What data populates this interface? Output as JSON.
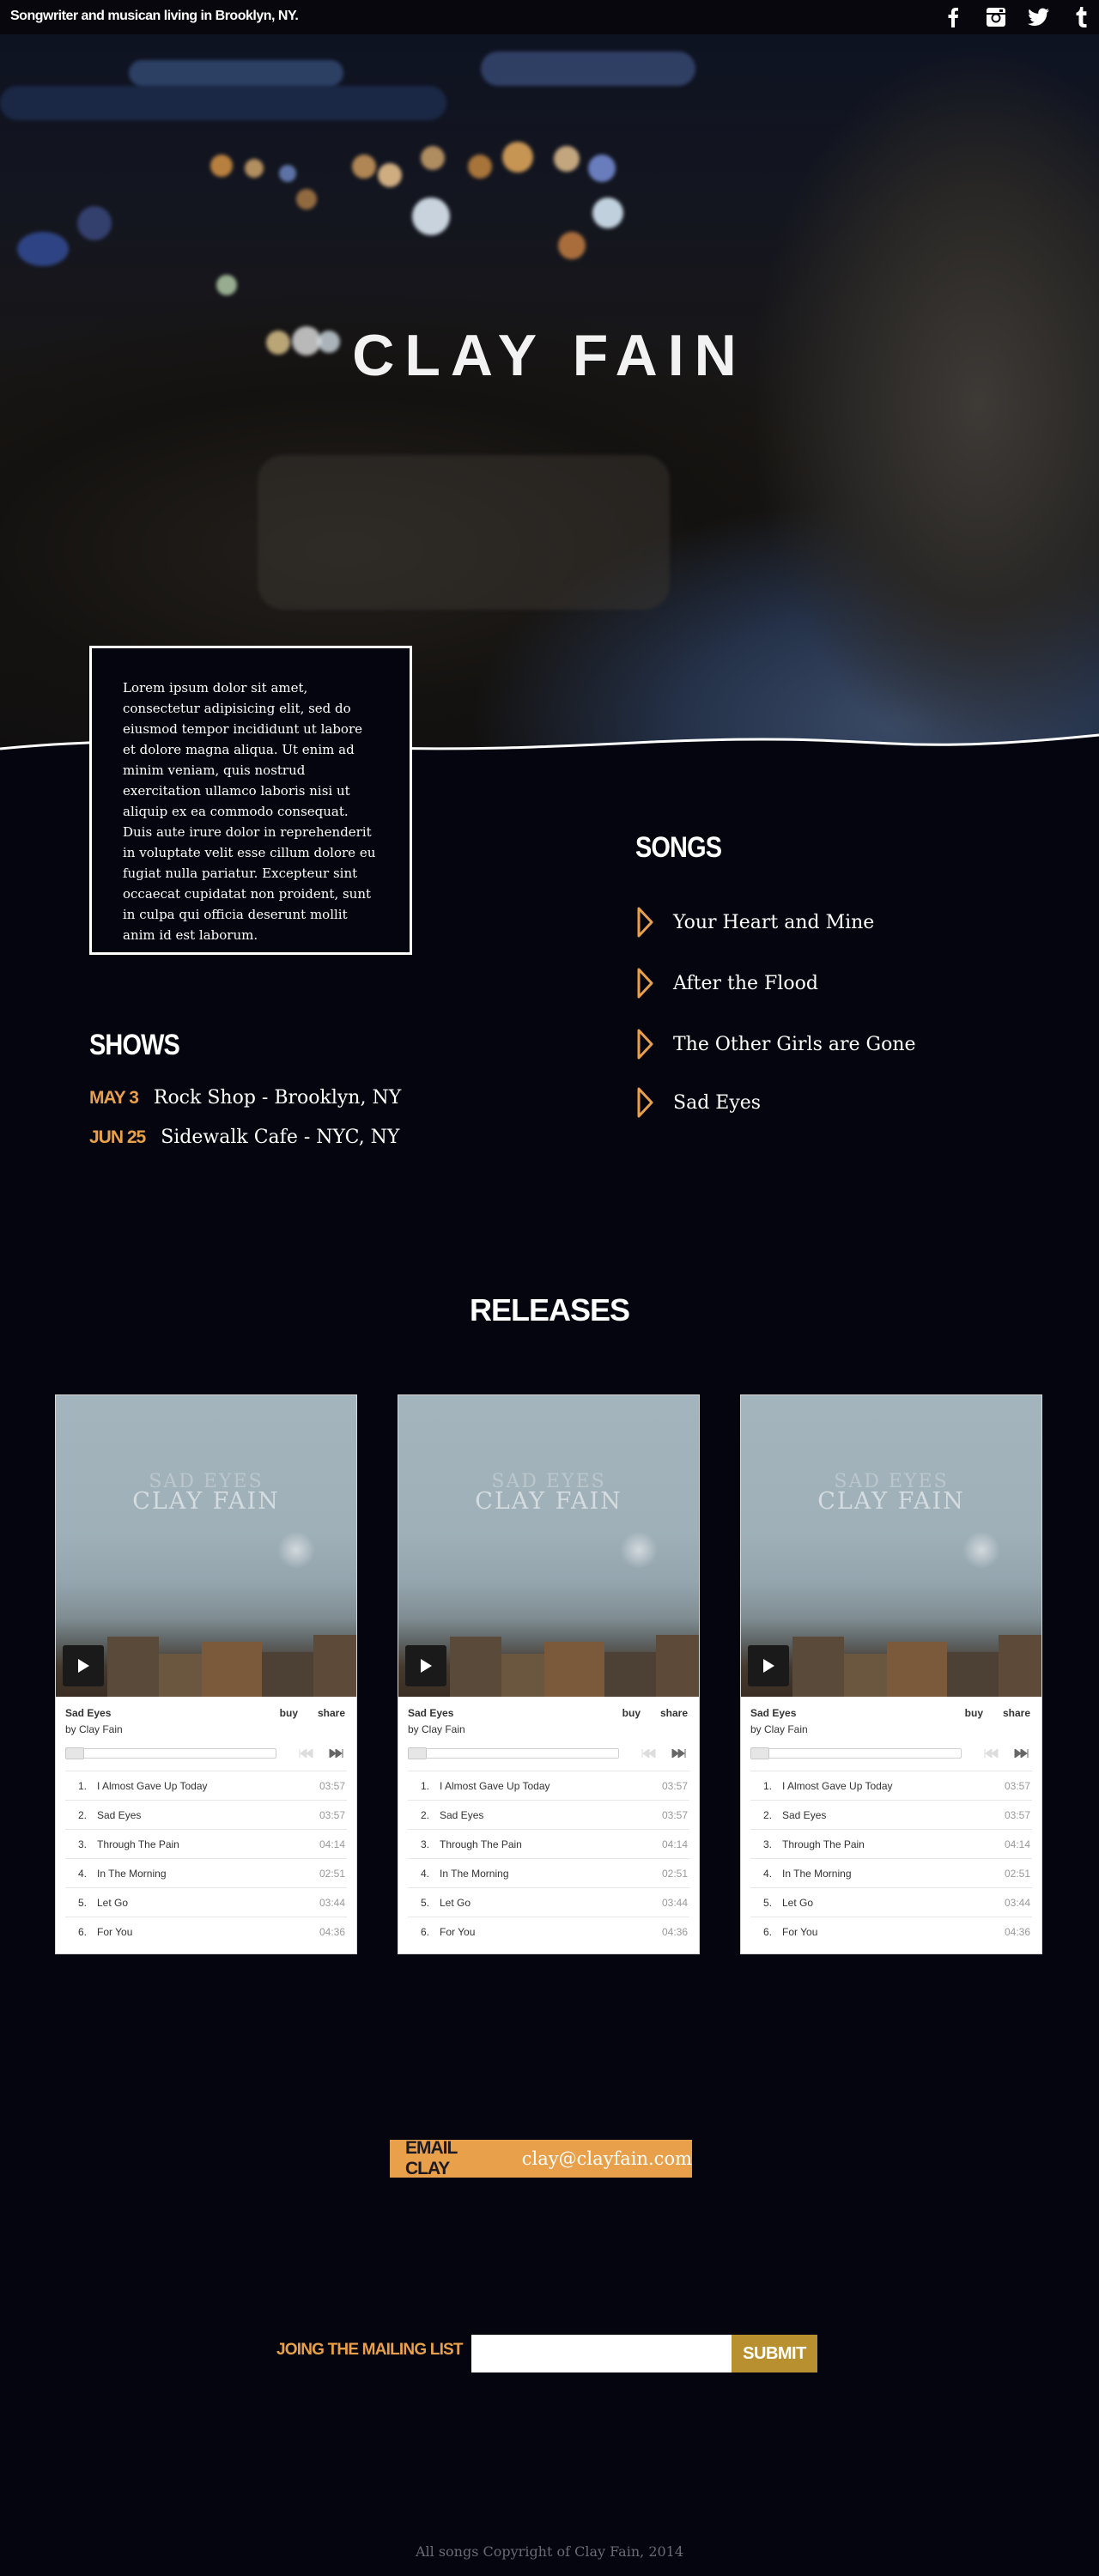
{
  "header": {
    "tagline": "Songwriter and musican living in Brooklyn, NY.",
    "social": [
      "facebook-icon",
      "instagram-icon",
      "twitter-icon",
      "tumblr-icon"
    ]
  },
  "hero": {
    "title": "CLAY FAIN"
  },
  "about": {
    "text": "Lorem ipsum dolor sit amet, consectetur adipisicing elit, sed do eiusmod tempor incididunt ut labore et dolore magna aliqua. Ut enim ad minim veniam, quis nostrud exercitation ullamco laboris nisi ut aliquip ex ea commodo consequat. Duis aute irure dolor in reprehenderit in voluptate velit esse cillum dolore eu fugiat nulla pariatur. Excepteur sint occaecat cupidatat non proident, sunt in culpa qui officia deserunt mollit anim id est laborum."
  },
  "shows": {
    "title": "SHOWS",
    "items": [
      {
        "date": "MAY 3",
        "venue": "Rock Shop - Brooklyn, NY"
      },
      {
        "date": "JUN 25",
        "venue": "Sidewalk Cafe - NYC, NY"
      }
    ]
  },
  "songs": {
    "title": "SONGS",
    "items": [
      "Your Heart and Mine",
      "After the Flood",
      "The Other Girls are Gone",
      "Sad Eyes"
    ]
  },
  "releases": {
    "title": "RELEASES",
    "players": [
      {
        "cover_line1": "SAD EYES",
        "cover_line2": "CLAY FAIN",
        "track": "Sad Eyes",
        "artist": "by Clay Fain",
        "buy": "buy",
        "share": "share",
        "tracks": [
          {
            "n": "1.",
            "title": "I Almost Gave Up Today",
            "dur": "03:57"
          },
          {
            "n": "2.",
            "title": "Sad Eyes",
            "dur": "03:57"
          },
          {
            "n": "3.",
            "title": "Through The Pain",
            "dur": "04:14"
          },
          {
            "n": "4.",
            "title": "In The Morning",
            "dur": "02:51"
          },
          {
            "n": "5.",
            "title": "Let Go",
            "dur": "03:44"
          },
          {
            "n": "6.",
            "title": "For You",
            "dur": "04:36"
          }
        ]
      },
      {
        "cover_line1": "SAD EYES",
        "cover_line2": "CLAY FAIN",
        "track": "Sad Eyes",
        "artist": "by Clay Fain",
        "buy": "buy",
        "share": "share",
        "tracks": [
          {
            "n": "1.",
            "title": "I Almost Gave Up Today",
            "dur": "03:57"
          },
          {
            "n": "2.",
            "title": "Sad Eyes",
            "dur": "03:57"
          },
          {
            "n": "3.",
            "title": "Through The Pain",
            "dur": "04:14"
          },
          {
            "n": "4.",
            "title": "In The Morning",
            "dur": "02:51"
          },
          {
            "n": "5.",
            "title": "Let Go",
            "dur": "03:44"
          },
          {
            "n": "6.",
            "title": "For You",
            "dur": "04:36"
          }
        ]
      },
      {
        "cover_line1": "SAD EYES",
        "cover_line2": "CLAY FAIN",
        "track": "Sad Eyes",
        "artist": "by Clay Fain",
        "buy": "buy",
        "share": "share",
        "tracks": [
          {
            "n": "1.",
            "title": "I Almost Gave Up Today",
            "dur": "03:57"
          },
          {
            "n": "2.",
            "title": "Sad Eyes",
            "dur": "03:57"
          },
          {
            "n": "3.",
            "title": "Through The Pain",
            "dur": "04:14"
          },
          {
            "n": "4.",
            "title": "In The Morning",
            "dur": "02:51"
          },
          {
            "n": "5.",
            "title": "Let Go",
            "dur": "03:44"
          },
          {
            "n": "6.",
            "title": "For You",
            "dur": "04:36"
          }
        ]
      }
    ]
  },
  "contact": {
    "label": "EMAIL CLAY",
    "email": "clay@clayfain.com"
  },
  "mailing": {
    "label": "JOING THE MAILING LIST",
    "placeholder": "",
    "submit": "SUBMIT"
  },
  "footer": {
    "text": "All songs Copyright of Clay Fain, 2014"
  },
  "colors": {
    "accent": "#e9a04a",
    "submit": "#b8902f",
    "background": "#05050f"
  }
}
